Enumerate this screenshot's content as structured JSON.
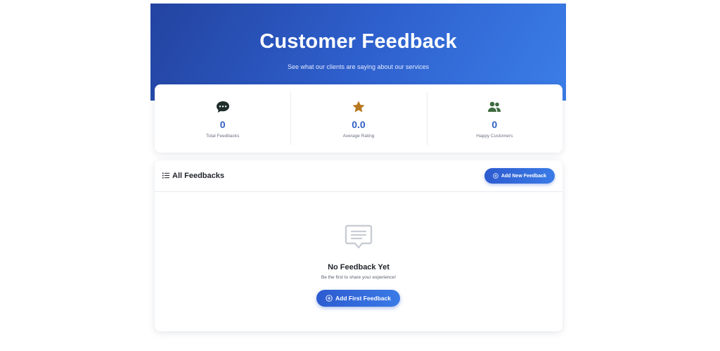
{
  "hero": {
    "title": "Customer Feedback",
    "subtitle": "See what our clients are saying about our services"
  },
  "stats": [
    {
      "icon": "speech-bubble-icon",
      "value": "0",
      "label": "Total Feedbacks",
      "color": "#1f2d2b"
    },
    {
      "icon": "star-icon",
      "value": "0.0",
      "label": "Average Rating",
      "color": "#b7791f"
    },
    {
      "icon": "users-icon",
      "value": "0",
      "label": "Happy Customers",
      "color": "#3f6b3f"
    }
  ],
  "list": {
    "title": "All Feedbacks",
    "add_button": "Add New Feedback"
  },
  "empty_state": {
    "icon": "message-square-icon",
    "title": "No Feedback Yet",
    "subtitle": "Be the first to share your experience!",
    "button": "Add First Feedback"
  },
  "colors": {
    "accent": "#2f5fc4",
    "hero_start": "#2343a0",
    "hero_end": "#3b7ee8"
  }
}
